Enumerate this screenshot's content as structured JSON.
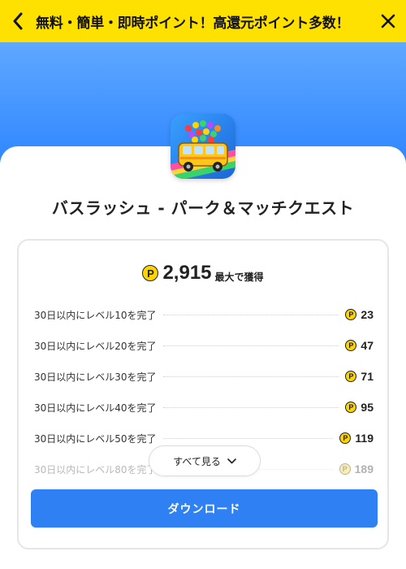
{
  "header": {
    "title": "無料・簡単・即時ポイント！高還元ポイント多数！",
    "back_icon": "chevron-left-icon",
    "close_icon": "close-icon",
    "background_color": "#ffe100"
  },
  "hero": {
    "gradient_top": "#5fa8ff",
    "gradient_bottom": "#2f86ff"
  },
  "app": {
    "name": "バスラッシュ - パーク＆マッチクエスト",
    "icon": "bus-game-app-icon"
  },
  "points": {
    "coin_symbol": "P",
    "total": "2,915",
    "total_suffix": "最大で獲得"
  },
  "tasks": [
    {
      "label": "30日以内にレベル10を完了",
      "points": "23"
    },
    {
      "label": "30日以内にレベル20を完了",
      "points": "47"
    },
    {
      "label": "30日以内にレベル30を完了",
      "points": "71"
    },
    {
      "label": "30日以内にレベル40を完了",
      "points": "95"
    },
    {
      "label": "30日以内にレベル50を完了",
      "points": "119"
    },
    {
      "label": "30日以内にレベル80を完了",
      "points": "189"
    }
  ],
  "see_all_label": "すべて見る",
  "download_label": "ダウンロード",
  "colors": {
    "accent": "#2f80f2",
    "coin": "#ffd400"
  }
}
